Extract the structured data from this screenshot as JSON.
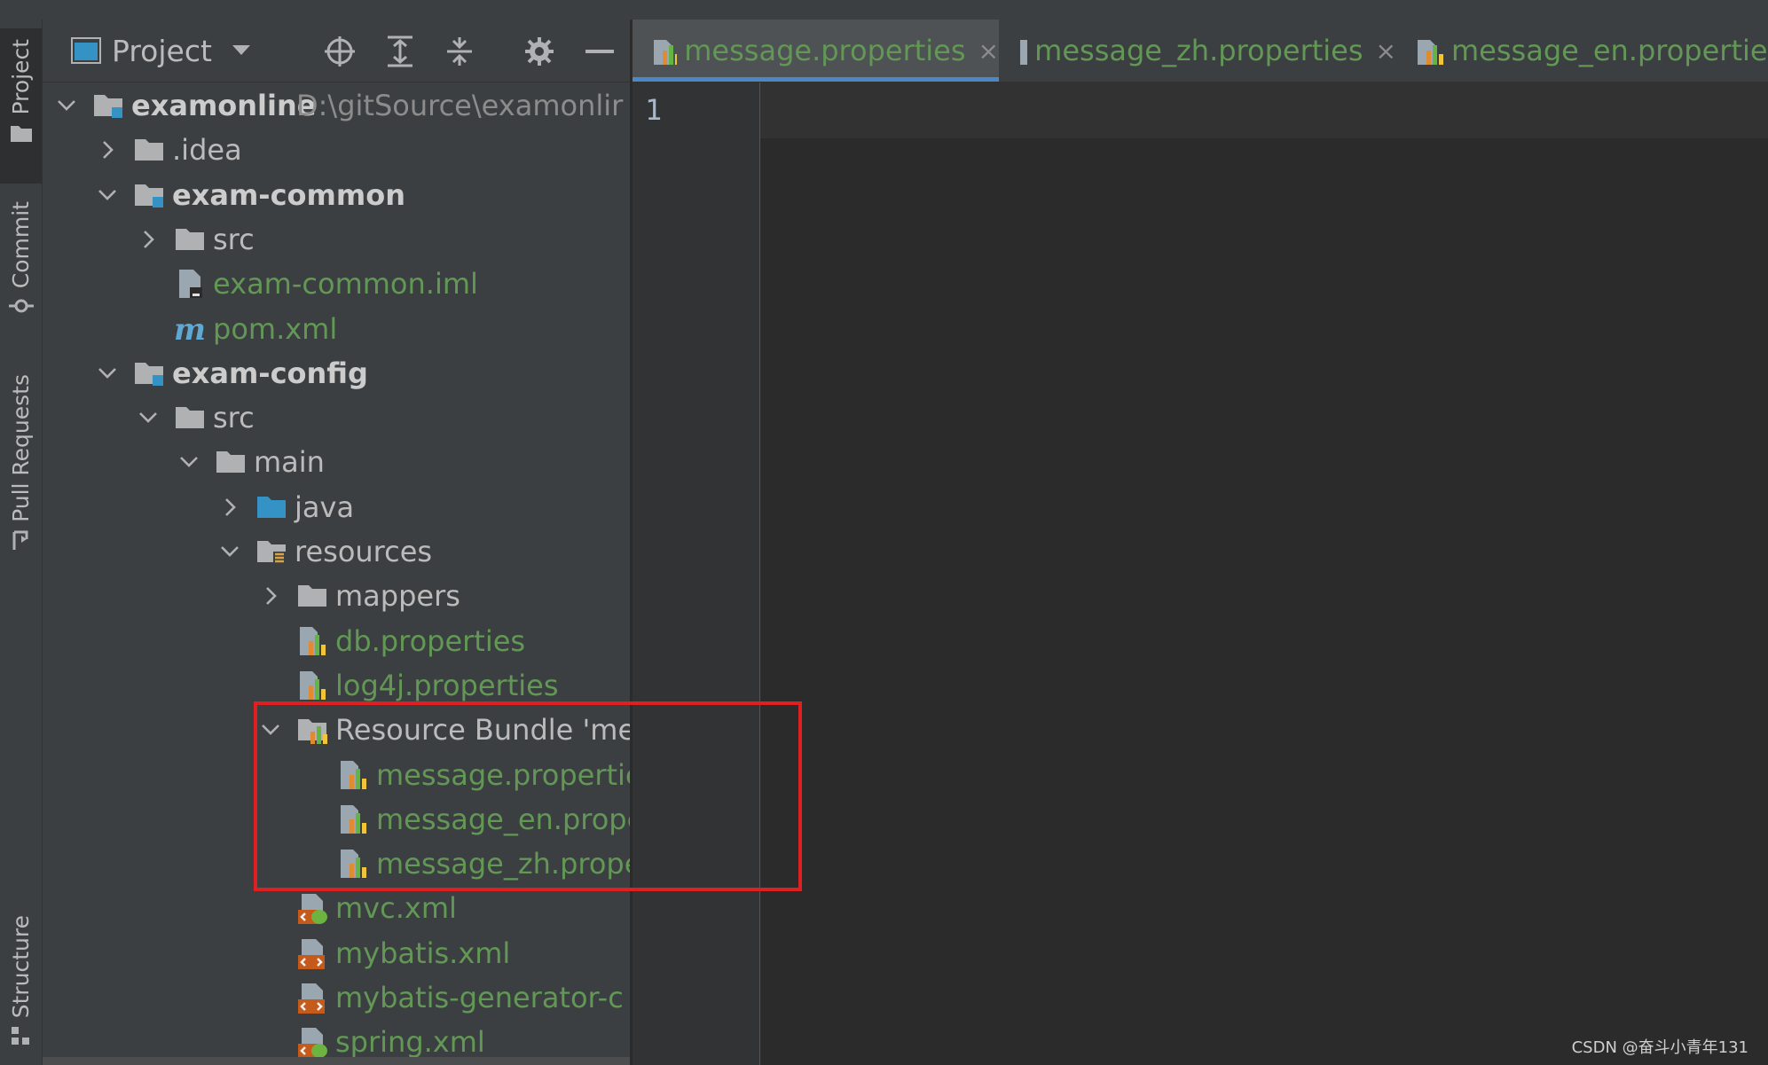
{
  "colors": {
    "accent": "#4a88c7",
    "highlight_box": "#e02020",
    "file_green": "#629755"
  },
  "tool_stripe": {
    "project": "Project",
    "commit": "Commit",
    "pull_requests": "Pull Requests",
    "structure": "Structure"
  },
  "project_panel": {
    "title": "Project",
    "buttons": [
      "crosshair-icon",
      "expand-all-icon",
      "collapse-all-icon",
      "gear-icon",
      "hide-icon"
    ]
  },
  "tree": [
    {
      "name": "examonline",
      "path": "D:\\gitSource\\examonlir",
      "icon": "module-folder-icon"
    },
    {
      "name": ".idea",
      "icon": "folder-icon"
    },
    {
      "name": "exam-common",
      "icon": "module-folder-icon"
    },
    {
      "name": "src",
      "icon": "folder-icon"
    },
    {
      "name": "exam-common.iml",
      "icon": "iml-file-icon"
    },
    {
      "name": "pom.xml",
      "icon": "maven-icon"
    },
    {
      "name": "exam-config",
      "icon": "module-folder-icon"
    },
    {
      "name": "src",
      "icon": "folder-icon"
    },
    {
      "name": "main",
      "icon": "folder-icon"
    },
    {
      "name": "java",
      "icon": "source-folder-icon"
    },
    {
      "name": "resources",
      "icon": "resources-folder-icon"
    },
    {
      "name": "mappers",
      "icon": "folder-icon"
    },
    {
      "name": "db.properties",
      "icon": "properties-icon"
    },
    {
      "name": "log4j.properties",
      "icon": "properties-icon"
    },
    {
      "name": "Resource Bundle 'me",
      "icon": "resource-bundle-icon"
    },
    {
      "name": "message.propertie",
      "icon": "properties-icon"
    },
    {
      "name": "message_en.prope",
      "icon": "properties-icon"
    },
    {
      "name": "message_zh.prope",
      "icon": "properties-icon"
    },
    {
      "name": "mvc.xml",
      "icon": "spring-xml-icon"
    },
    {
      "name": "mybatis.xml",
      "icon": "xml-icon"
    },
    {
      "name": "mybatis-generator-c",
      "icon": "xml-icon"
    },
    {
      "name": "spring.xml",
      "icon": "spring-xml-icon"
    }
  ],
  "editor": {
    "tabs": [
      {
        "label": "message.properties",
        "close": "×"
      },
      {
        "label": "message_zh.properties",
        "close": "×"
      },
      {
        "label": "message_en.properties"
      }
    ],
    "line_number": "1"
  },
  "watermark": "CSDN @奋斗小青年131"
}
